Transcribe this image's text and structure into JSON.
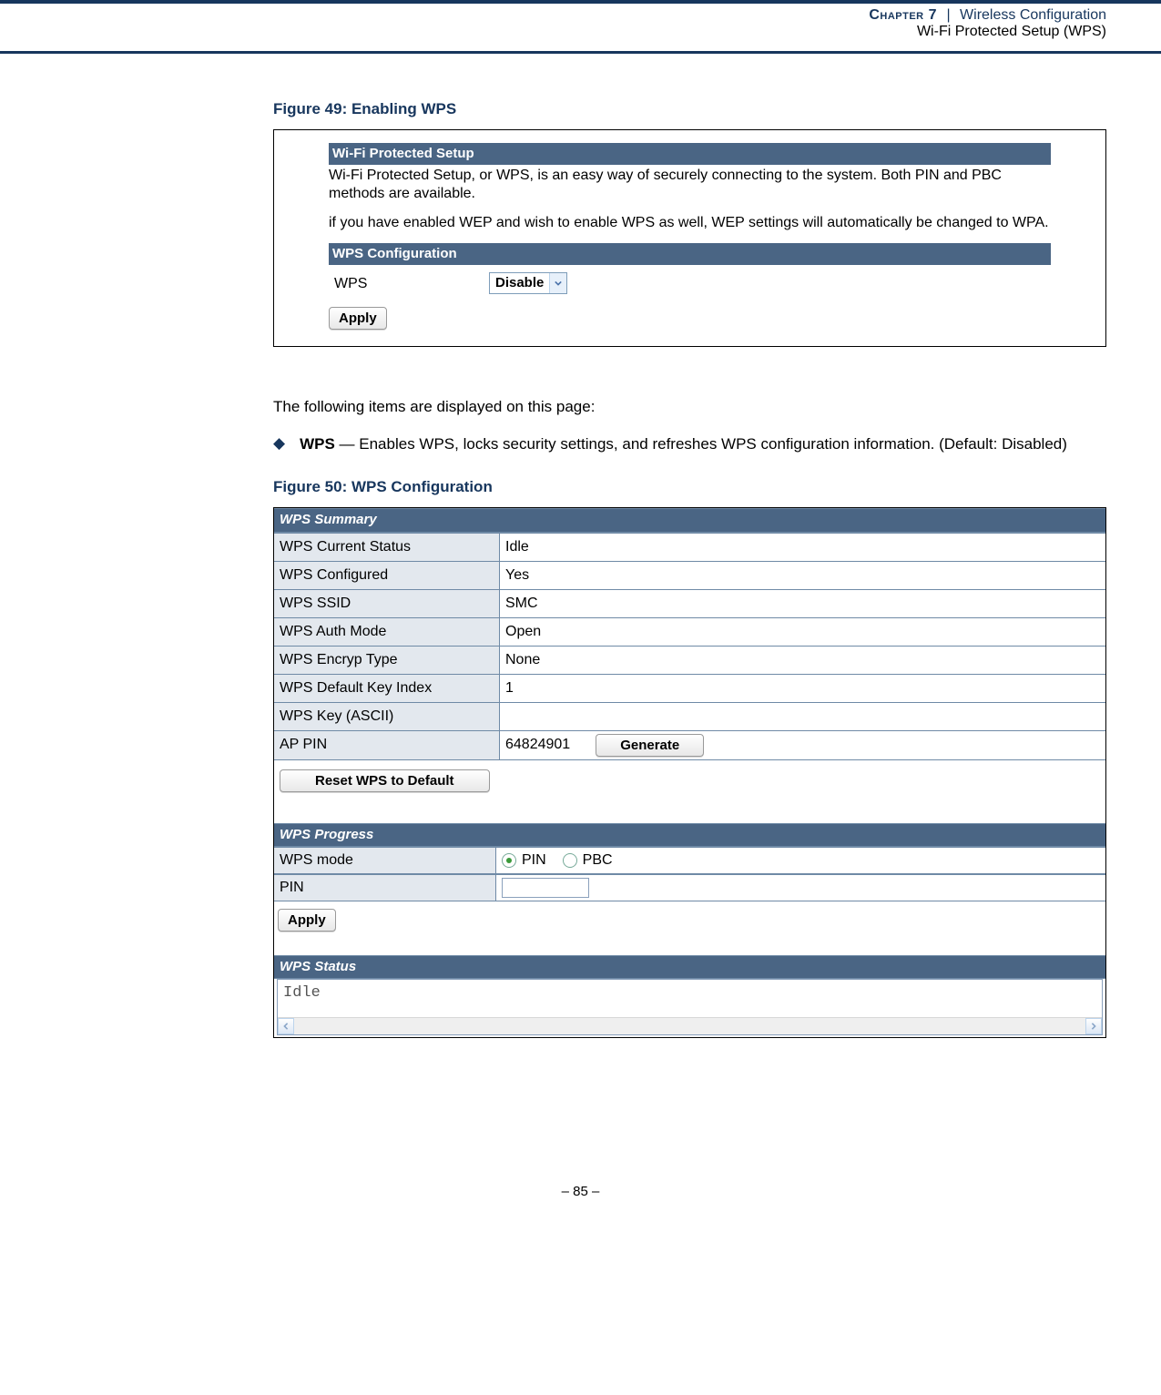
{
  "header": {
    "chapter_word": "Chapter",
    "chapter_num": "7",
    "sep": "|",
    "topic": "Wireless Configuration",
    "subtopic": "Wi-Fi Protected Setup (WPS)"
  },
  "fig49": {
    "caption": "Figure 49:  Enabling WPS",
    "section1_title": "Wi-Fi Protected Setup",
    "desc_line1": "Wi-Fi Protected Setup, or WPS, is an easy way of securely connecting to the system. Both PIN and PBC methods are available.",
    "desc_line2": "if you have enabled WEP and wish to enable WPS as well, WEP settings will automatically be changed to WPA.",
    "section2_title": "WPS Configuration",
    "wps_label": "WPS",
    "wps_select_value": "Disable",
    "apply_label": "Apply"
  },
  "intro_text": "The following items are displayed on this page:",
  "bullet": {
    "term": "WPS",
    "sep": " — ",
    "desc": "Enables WPS, locks security settings, and refreshes WPS configuration information. (Default: Disabled)"
  },
  "fig50": {
    "caption": "Figure 50:  WPS Configuration",
    "summary_title": "WPS Summary",
    "rows": [
      {
        "label": "WPS Current Status",
        "value": "Idle"
      },
      {
        "label": "WPS Configured",
        "value": "Yes"
      },
      {
        "label": "WPS SSID",
        "value": "SMC"
      },
      {
        "label": "WPS Auth Mode",
        "value": "Open"
      },
      {
        "label": "WPS Encryp Type",
        "value": "None"
      },
      {
        "label": "WPS Default Key Index",
        "value": "1"
      },
      {
        "label": "WPS Key (ASCII)",
        "value": ""
      }
    ],
    "ap_pin_label": "AP PIN",
    "ap_pin_value": "64824901",
    "generate_label": "Generate",
    "reset_label": "Reset WPS to Default",
    "progress_title": "WPS Progress",
    "mode_label": "WPS mode",
    "mode_pin": "PIN",
    "mode_pbc": "PBC",
    "pin_label": "PIN",
    "pin_input_value": "",
    "apply_label": "Apply",
    "status_title": "WPS Status",
    "status_value": "Idle"
  },
  "footer": "–  85  –"
}
